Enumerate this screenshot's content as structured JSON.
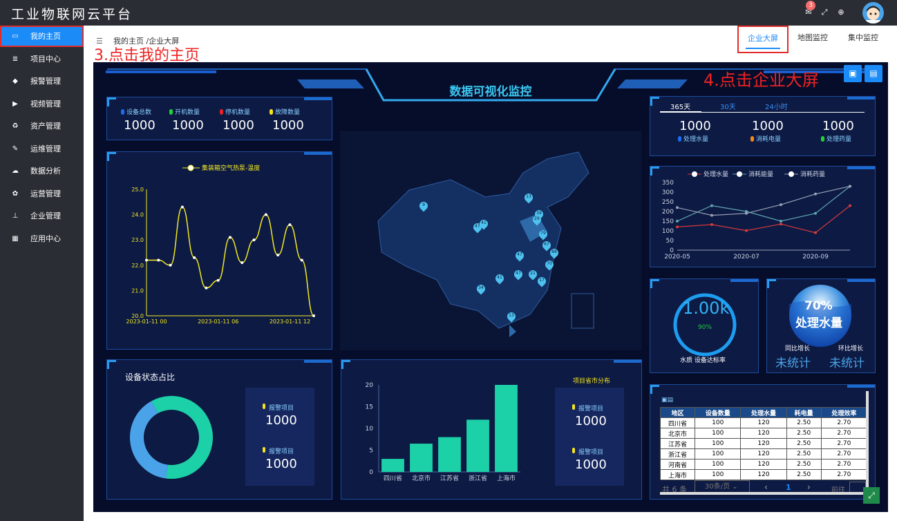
{
  "app": {
    "title": "工业物联网云平台",
    "badge": "3"
  },
  "sidebar": {
    "items": [
      {
        "label": "我的主页",
        "icon": "monitor-icon"
      },
      {
        "label": "项目中心",
        "icon": "list-icon"
      },
      {
        "label": "报警管理",
        "icon": "bell-icon"
      },
      {
        "label": "视频管理",
        "icon": "video-icon"
      },
      {
        "label": "资产管理",
        "icon": "recycle-icon"
      },
      {
        "label": "运维管理",
        "icon": "wrench-icon"
      },
      {
        "label": "数据分析",
        "icon": "cloud-icon"
      },
      {
        "label": "运营管理",
        "icon": "gears-icon"
      },
      {
        "label": "企业管理",
        "icon": "org-icon"
      },
      {
        "label": "应用中心",
        "icon": "grid-icon"
      }
    ]
  },
  "breadcrumb": "我的主页 /企业大屏",
  "annotations": {
    "step3": "3.点击我的主页",
    "step4": "4.点击企业大屏"
  },
  "tabs": [
    "企业大屏",
    "地图监控",
    "集中监控"
  ],
  "dashboard": {
    "title": "数据可视化监控",
    "stats": [
      {
        "label": "设备总数",
        "value": "1000",
        "color": "#1b6ef3"
      },
      {
        "label": "开机数量",
        "value": "1000",
        "color": "#22d33c"
      },
      {
        "label": "停机数量",
        "value": "1000",
        "color": "#e82323"
      },
      {
        "label": "故障数量",
        "value": "1000",
        "color": "#f5e61b"
      }
    ],
    "time_tabs": [
      "365天",
      "30天",
      "24小时"
    ],
    "usage": [
      {
        "label": "处理水量",
        "value": "1000",
        "color": "#1b6ef3"
      },
      {
        "label": "消耗电量",
        "value": "1000",
        "color": "#f5891b"
      },
      {
        "label": "处理药量",
        "value": "1000",
        "color": "#22d33c"
      }
    ],
    "gauge": {
      "value": "1.00k",
      "pct": "90%",
      "label": "水质 设备达标率"
    },
    "water": {
      "pct": "70%",
      "label": "处理水量",
      "yoy": "同比增长",
      "mom": "环比增长",
      "yoy_val": "未统计",
      "mom_val": "未统计"
    },
    "device_status": {
      "title": "设备状态占比",
      "items": [
        {
          "label": "报警项目",
          "value": "1000"
        },
        {
          "label": "报警项目",
          "value": "1000"
        }
      ]
    },
    "region": {
      "title": "项目省市分布",
      "items": [
        {
          "label": "报警项目",
          "value": "1000"
        },
        {
          "label": "报警项目",
          "value": "1000"
        }
      ]
    },
    "map_markers": [
      "9",
      "47",
      "41",
      "13",
      "39",
      "29",
      "88",
      "67",
      "79",
      "47",
      "47",
      "21",
      "34",
      "41",
      "17",
      "70",
      "13"
    ],
    "table": {
      "headers": [
        "地区",
        "设备数量",
        "处理水量",
        "耗电量",
        "处理效率"
      ],
      "rows": [
        [
          "四川省",
          "100",
          "120",
          "2.50",
          "2.70"
        ],
        [
          "北京市",
          "100",
          "120",
          "2.50",
          "2.70"
        ],
        [
          "江苏省",
          "100",
          "120",
          "2.50",
          "2.70"
        ],
        [
          "浙江省",
          "100",
          "120",
          "2.50",
          "2.70"
        ],
        [
          "河南省",
          "100",
          "120",
          "2.50",
          "2.70"
        ],
        [
          "上海市",
          "100",
          "120",
          "2.50",
          "2.70"
        ]
      ],
      "footer": {
        "total": "共 6 条",
        "page_size": "30条/页",
        "page": "1",
        "goto": "前往"
      }
    }
  },
  "chart_data": [
    {
      "type": "line",
      "title": "",
      "series": [
        {
          "name": "集装箱空气热泵-温度",
          "values": [
            22.2,
            22.2,
            22.0,
            24.3,
            22.3,
            21.1,
            21.4,
            23.1,
            22.1,
            23.0,
            24.0,
            22.4,
            23.6,
            22.2,
            20.0
          ]
        }
      ],
      "x": [
        "2023-01-11 00",
        "",
        "",
        "",
        "",
        "",
        "2023-01-11 06",
        "",
        "",
        "",
        "",
        "",
        "2023-01-11 12",
        "",
        ""
      ],
      "xticks": [
        "2023-01-11 00",
        "2023-01-11 06",
        "2023-01-11 12"
      ],
      "yticks": [
        "20.0",
        "21.0",
        "22.0",
        "23.0",
        "24.0",
        "25.0"
      ],
      "ylim": [
        20,
        25
      ],
      "color": "#f2ea1f"
    },
    {
      "type": "line",
      "categories": [
        "2020-05",
        "2020-06",
        "2020-07",
        "2020-08",
        "2020-09",
        "2020-10"
      ],
      "xticks": [
        "2020-05",
        "2020-07",
        "2020-09"
      ],
      "yticks": [
        "0",
        "50",
        "100",
        "150",
        "200",
        "250",
        "300",
        "350"
      ],
      "ylim": [
        0,
        350
      ],
      "series": [
        {
          "name": "处理水量",
          "values": [
            120,
            132,
            101,
            135,
            90,
            230
          ],
          "color": "#d63a3a"
        },
        {
          "name": "消耗能量",
          "values": [
            150,
            230,
            200,
            150,
            190,
            330
          ],
          "color": "#5fa7b0"
        },
        {
          "name": "消耗药量",
          "values": [
            220,
            180,
            190,
            235,
            290,
            330
          ],
          "color": "#9aa3b5"
        }
      ]
    },
    {
      "type": "pie",
      "title": "设备状态占比",
      "values": [
        60,
        40
      ],
      "colors": [
        "#1cd1a8",
        "#4aa3e8"
      ]
    },
    {
      "type": "bar",
      "title": "项目省市分布",
      "categories": [
        "四川省",
        "北京市",
        "江苏省",
        "浙江省",
        "上海市"
      ],
      "values": [
        3,
        6.5,
        8,
        12,
        20
      ],
      "yticks": [
        "0",
        "5",
        "10",
        "15",
        "20"
      ],
      "ylim": [
        0,
        20
      ],
      "color": "#1cd1a8"
    }
  ]
}
